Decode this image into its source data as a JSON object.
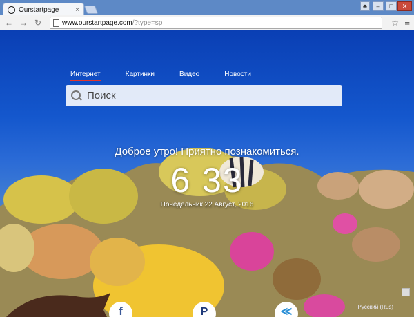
{
  "browser": {
    "tab_title": "Ourstartpage",
    "tab_close": "×",
    "url_host": "www.ourstartpage.com",
    "url_path": "/?type=sp"
  },
  "nav": {
    "tabs": [
      "Интернет",
      "Картинки",
      "Видео",
      "Новости"
    ],
    "active": "Интернет"
  },
  "search": {
    "placeholder": "Поиск"
  },
  "greeting": "Доброе утро! Приятно познакомиться.",
  "clock": "6 33",
  "date": "Понедельник 22 Август, 2016",
  "footer": {
    "language": "Русский (Rus)"
  },
  "social": [
    {
      "name": "facebook",
      "glyph": "f",
      "color": "#3b5998"
    },
    {
      "name": "paypal",
      "glyph": "P",
      "color": "#1f3a7a"
    },
    {
      "name": "share",
      "glyph": "≪",
      "color": "#2a8fd6"
    }
  ],
  "icons": [
    "back-arrow-icon",
    "forward-arrow-icon",
    "reload-icon",
    "home-icon",
    "page-icon",
    "star-icon",
    "menu-icon",
    "search-icon"
  ]
}
